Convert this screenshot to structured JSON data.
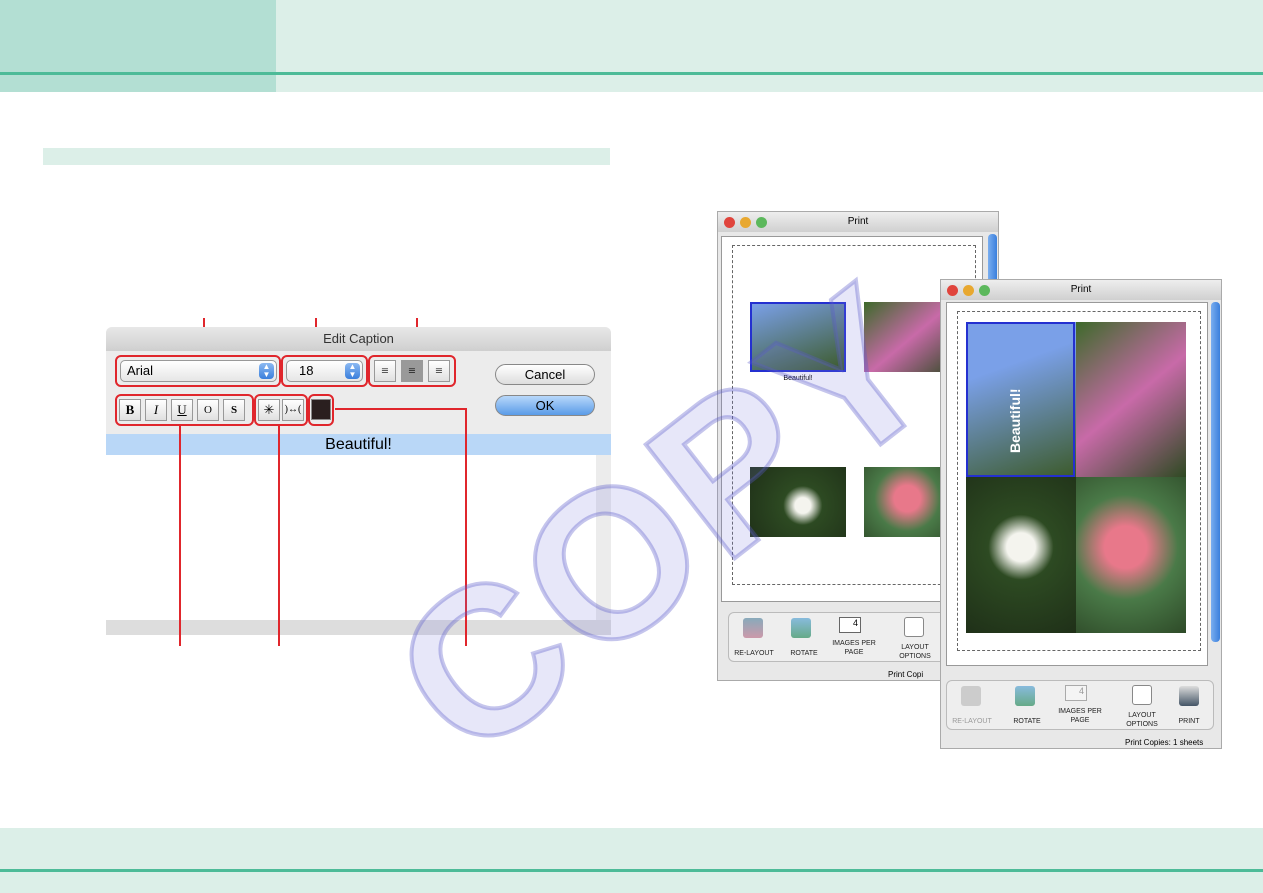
{
  "edit_caption": {
    "title": "Edit Caption",
    "font": "Arial",
    "size": "18",
    "cancel_label": "Cancel",
    "ok_label": "OK",
    "style_buttons": [
      "B",
      "I",
      "U",
      "O",
      "S"
    ],
    "spacing_buttons": [
      "condense",
      "expand"
    ],
    "text_color": "#2a1f1f",
    "caption_text": "Beautiful!",
    "alignment_selected": "center"
  },
  "print_back": {
    "title": "Print",
    "caption": "Beautiful!",
    "images_per_page": "4",
    "toolbar": [
      "RE-LAYOUT",
      "ROTATE",
      "IMAGES PER PAGE",
      "LAYOUT OPTIONS"
    ],
    "status": "Print Copi"
  },
  "print_front": {
    "title": "Print",
    "caption": "Beautiful!",
    "images_per_page": "4",
    "toolbar": [
      "RE-LAYOUT",
      "ROTATE",
      "IMAGES PER PAGE",
      "LAYOUT OPTIONS",
      "PRINT"
    ],
    "status": "Print Copies: 1 sheets"
  },
  "watermark": "COPY",
  "colors": {
    "accent": "#4dbb98",
    "header": "#dcefe8",
    "header_left": "#b3dfd3",
    "callout": "#e0262c"
  }
}
